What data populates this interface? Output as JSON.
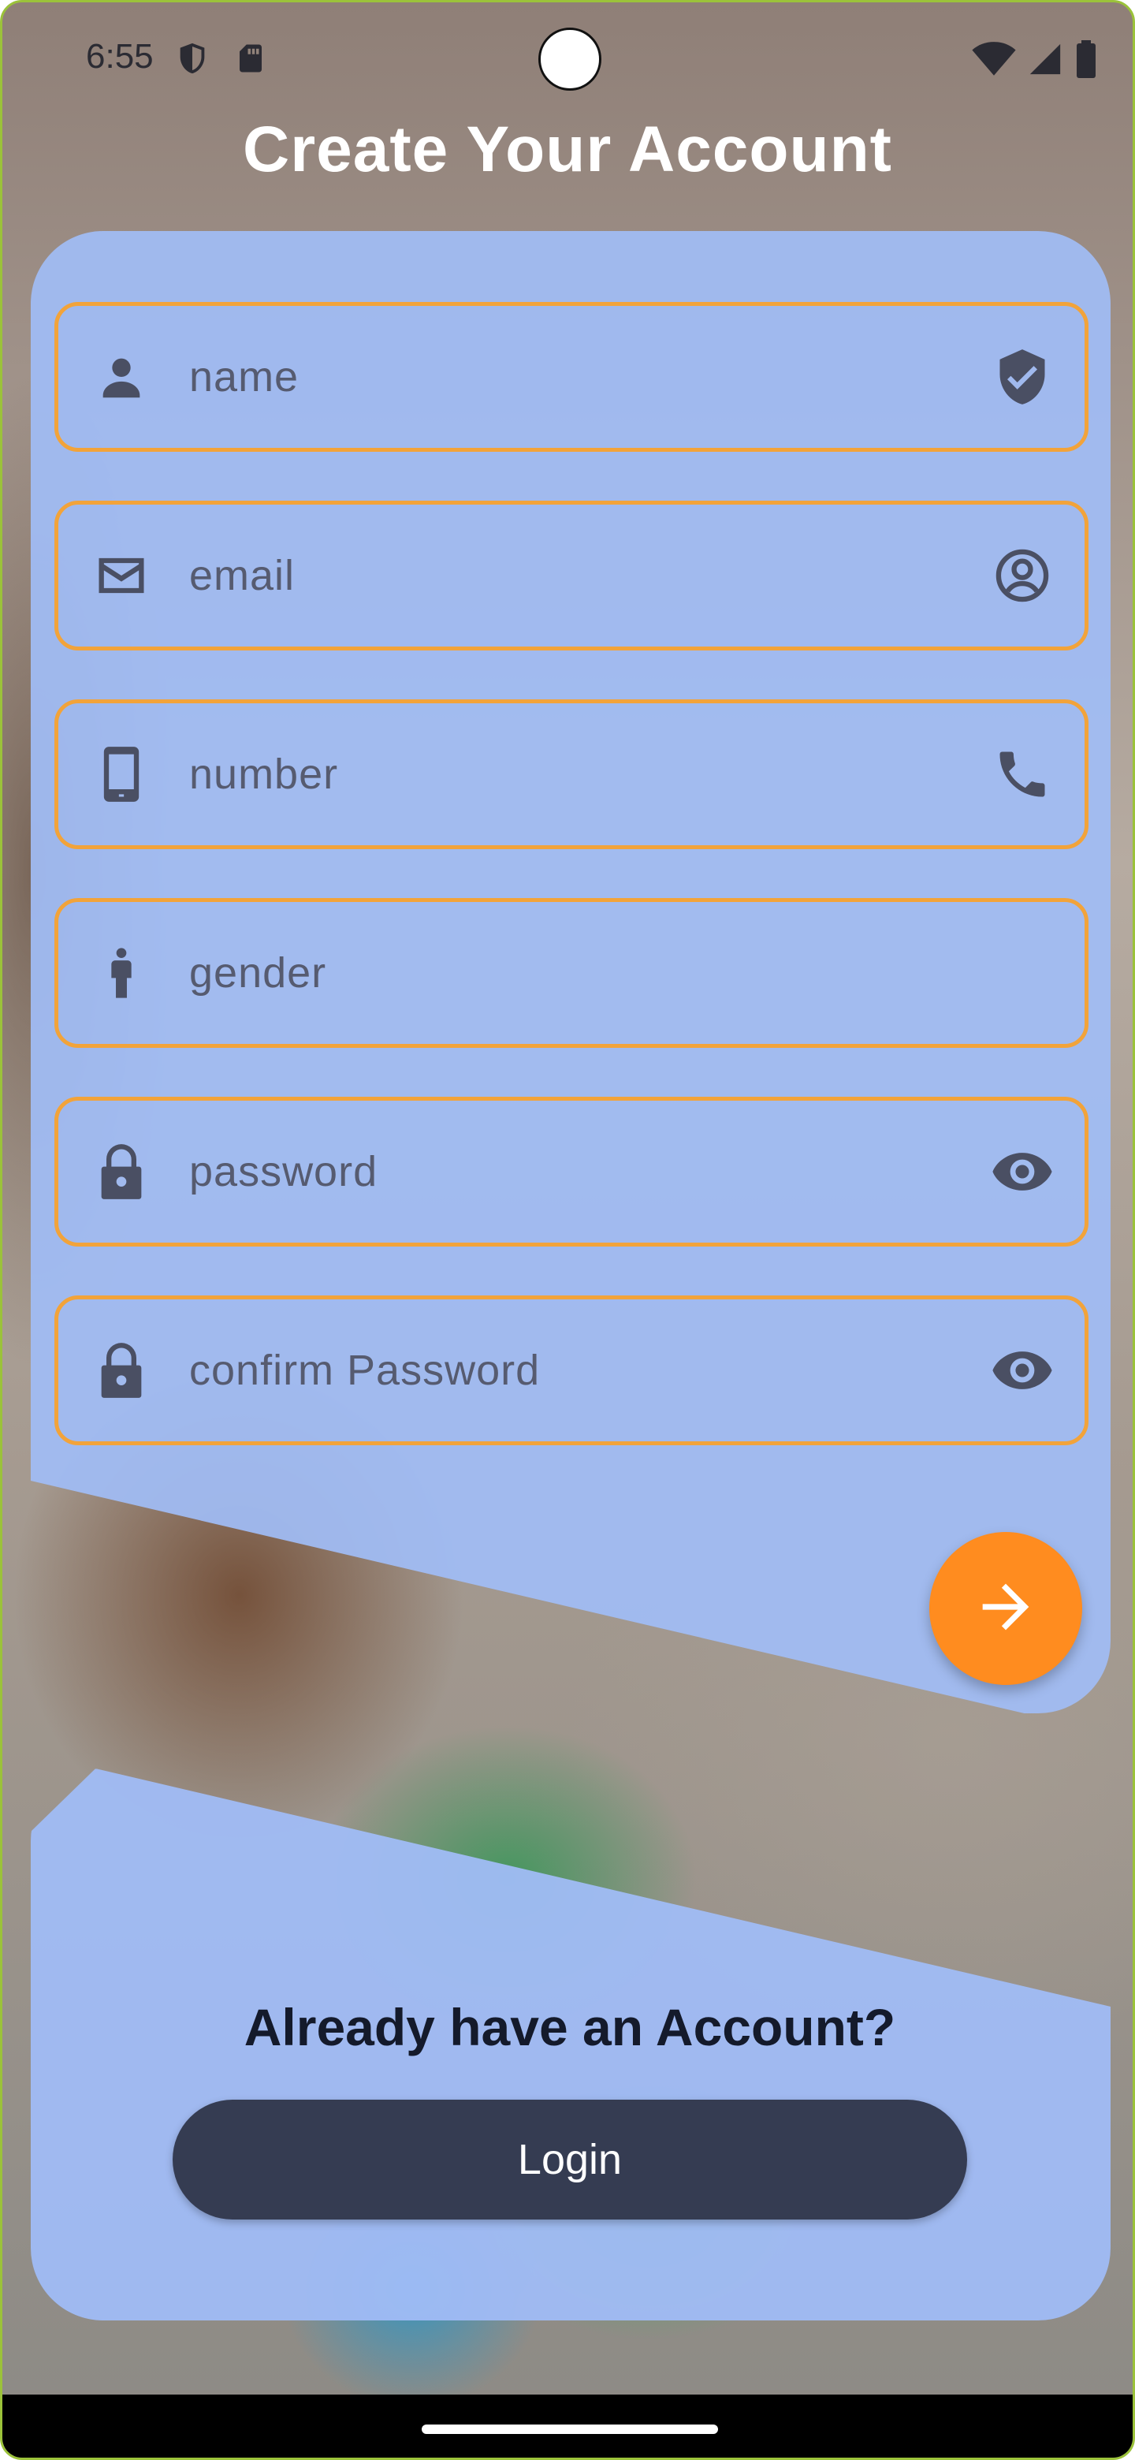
{
  "status_bar": {
    "time": "6:55",
    "left_icons": [
      "shield-icon",
      "sd-card-icon"
    ],
    "right_icons": [
      "wifi-icon",
      "signal-icon",
      "battery-icon"
    ]
  },
  "title": "Create Your Account",
  "form": {
    "fields": [
      {
        "placeholder": "name",
        "leading_icon": "person-icon",
        "trailing_icon": "verified-shield-icon"
      },
      {
        "placeholder": "email",
        "leading_icon": "mail-icon",
        "trailing_icon": "account-circle-icon"
      },
      {
        "placeholder": "number",
        "leading_icon": "smartphone-icon",
        "trailing_icon": "phone-icon"
      },
      {
        "placeholder": "gender",
        "leading_icon": "man-icon",
        "trailing_icon": ""
      },
      {
        "placeholder": "password",
        "leading_icon": "lock-icon",
        "trailing_icon": "eye-icon"
      },
      {
        "placeholder": "confirm Password",
        "leading_icon": "lock-icon",
        "trailing_icon": "eye-icon"
      }
    ],
    "submit_icon": "arrow-right-icon"
  },
  "login_section": {
    "prompt": "Already have an Account?",
    "button_label": "Login"
  },
  "colors": {
    "card": "#a0bcf5",
    "field_border": "#f2a33a",
    "fab": "#ff8c1f",
    "login_button": "#353c52",
    "icon": "#4a4f63"
  }
}
